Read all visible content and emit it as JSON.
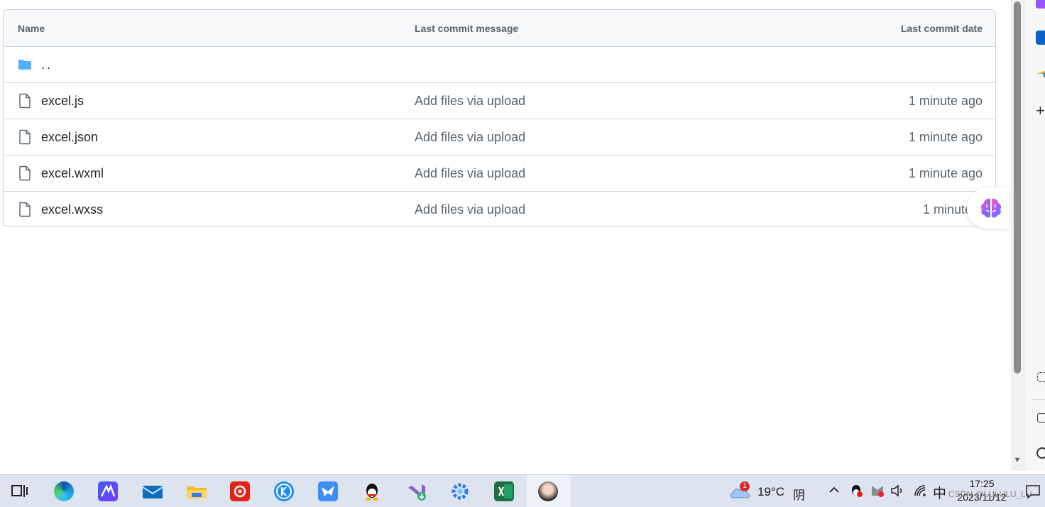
{
  "table": {
    "headers": {
      "name": "Name",
      "message": "Last commit message",
      "date": "Last commit date"
    },
    "parent_row": {
      "name": ".."
    },
    "rows": [
      {
        "name": "excel.js",
        "message": "Add files via upload",
        "date": "1 minute ago"
      },
      {
        "name": "excel.json",
        "message": "Add files via upload",
        "date": "1 minute ago"
      },
      {
        "name": "excel.wxml",
        "message": "Add files via upload",
        "date": "1 minute ago"
      },
      {
        "name": "excel.wxss",
        "message": "Add files via upload",
        "date": "1 minute a"
      }
    ]
  },
  "taskbar": {
    "weather": {
      "temp": "19°C",
      "condition": "阴",
      "badge": "1"
    },
    "ime": "中",
    "time": "17:25",
    "date": "2023/11/12",
    "watermark": "CSDN @LULULU_LU"
  },
  "colors": {
    "folder": "#54aeff",
    "border": "#d0d7de",
    "header_bg": "#f6f8fa",
    "muted_text": "#59636e"
  },
  "icons": {
    "folder": "folder-icon",
    "file": "file-icon",
    "brain": "brain-icon",
    "sidebar": [
      "copilot-icon",
      "outlook-icon",
      "favorites-icon",
      "add-icon",
      "screenshot-icon",
      "open-external-icon",
      "settings-icon"
    ],
    "taskbar": [
      "task-view-icon",
      "edge-icon",
      "vscode-like-icon",
      "mail-icon",
      "file-explorer-icon",
      "netease-music-icon",
      "kugou-icon",
      "feishu-icon",
      "qq-icon",
      "visual-studio-installer-icon",
      "settings-gear-app-icon",
      "excel-icon",
      "avatar-app-icon"
    ]
  }
}
